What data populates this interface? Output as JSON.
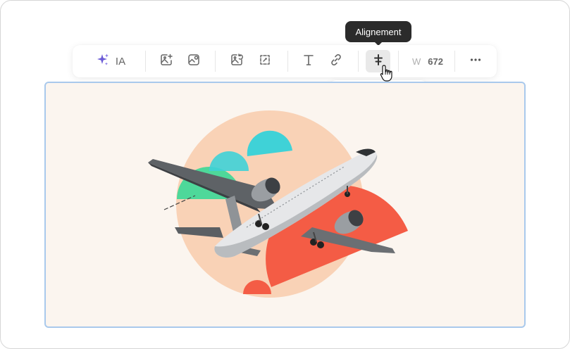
{
  "tooltip": {
    "text": "Alignement"
  },
  "toolbar": {
    "ia_label": "IA",
    "word_label": "W",
    "word_count": "672",
    "icons": [
      "sparkle-icon",
      "image-add-icon",
      "image-edit-icon",
      "image-rotate-icon",
      "image-crop-icon",
      "text-icon",
      "link-icon",
      "align-center-icon",
      "more-icon"
    ]
  },
  "alignment_menu": {
    "options": [
      "align-left",
      "align-center",
      "align-right"
    ],
    "selected": "align-center"
  },
  "colors": {
    "accent_ia": "#6b5bd6",
    "selection_border": "#a9c9ec",
    "tooltip_bg": "#2b2b2b",
    "peach": "#f9d2b6",
    "coral": "#f45c45",
    "teal": "#3fd2d7",
    "green": "#4ed89a"
  }
}
